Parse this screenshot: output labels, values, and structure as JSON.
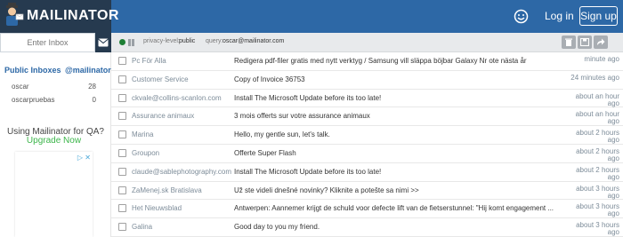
{
  "header": {
    "logo": "MAILINATOR",
    "login": "Log in",
    "signup": "Sign up"
  },
  "sidebar": {
    "inbox_placeholder": "Enter Inbox",
    "public_inboxes_label": "Public Inboxes",
    "domain_label": "@mailinator",
    "inboxes": [
      {
        "name": "oscar",
        "count": "28"
      },
      {
        "name": "oscarpruebas",
        "count": "0"
      }
    ],
    "qa_title": "Using Mailinator for QA?",
    "qa_link": "Upgrade Now",
    "ad_icon": "▷ ✕"
  },
  "toolbar": {
    "privacy_label": "privacy-level:",
    "privacy_value": "public",
    "query_label": "query:",
    "query_value": "oscar@mailinator.com",
    "icons": [
      "trash-icon",
      "save-icon",
      "forward-icon"
    ]
  },
  "messages": [
    {
      "from": "Pc För Alla",
      "subject": "Redigera pdf-filer gratis med nytt verktyg / Samsung vill släppa böjbar Galaxy Nr ote nästa år",
      "time": "minute ago"
    },
    {
      "from": "Customer Service",
      "subject": "Copy of Invoice 36753",
      "time": "24 minutes ago"
    },
    {
      "from": "ckvale@collins-scanlon.com",
      "subject": "Install The Microsoft Update before its too late!",
      "time": "about an hour ago"
    },
    {
      "from": "Assurance animaux",
      "subject": "3 mois offerts sur votre assurance animaux",
      "time": "about an hour ago"
    },
    {
      "from": "Marina",
      "subject": "Hello, my gentle sun, let's talk.",
      "time": "about 2 hours ago"
    },
    {
      "from": "Groupon",
      "subject": "Offerte Super Flash",
      "time": "about 2 hours ago"
    },
    {
      "from": "claude@sablephotography.com",
      "subject": "Install The Microsoft Update before its too late!",
      "time": "about 2 hours ago"
    },
    {
      "from": "ZaMenej.sk Bratislava",
      "subject": "Už ste videli dnešné novinky? Kliknite a potešte sa nimi >>",
      "time": "about 3 hours ago"
    },
    {
      "from": "Het Nieuwsblad",
      "subject": "Antwerpen: Aannemer krijgt de schuld voor defecte lift van de fietserstunnel: \"Hij komt engagement ...",
      "time": "about 3 hours ago"
    },
    {
      "from": "Galina",
      "subject": "Good day to you my friend.",
      "time": "about 3 hours ago"
    }
  ]
}
